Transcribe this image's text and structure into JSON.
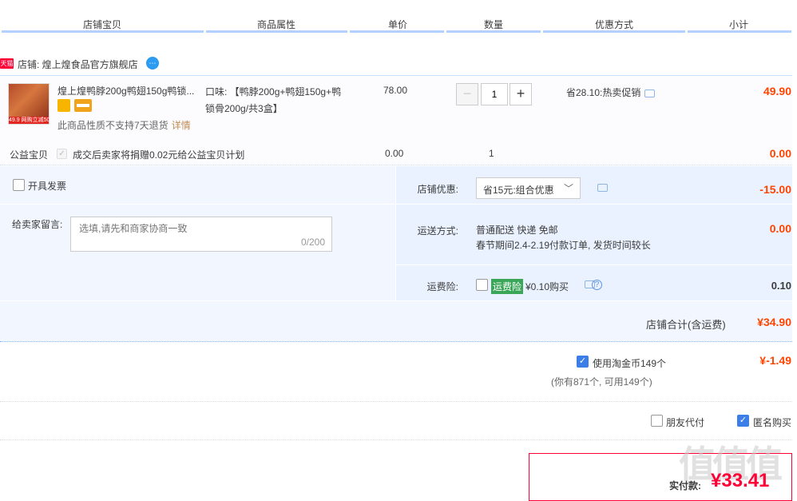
{
  "header": {
    "columns": [
      "店铺宝贝",
      "商品属性",
      "单价",
      "数量",
      "优惠方式",
      "小计"
    ]
  },
  "shop": {
    "badge": "天猫",
    "name": "店铺: 煌上煌食品官方旗舰店"
  },
  "item": {
    "thumb_tag": "49.9 网购立减50元",
    "title": "煌上煌鸭脖200g鸭翅150g鸭锁...",
    "no_return": "此商品性质不支持7天退货",
    "details_link": "详情",
    "attr": "口味: 【鸭脖200g+鸭翅150g+鸭锁骨200g/共3盒】",
    "price": "78.00",
    "qty_minus": "−",
    "qty_plus": "+",
    "quantity": "1",
    "promo": "省28.10:热卖促销",
    "subtotal": "49.90"
  },
  "charity": {
    "label": "公益宝贝",
    "text": "成交后卖家将捐赠0.02元给公益宝贝计划",
    "price": "0.00",
    "qty": "1",
    "subtotal": "0.00"
  },
  "order": {
    "invoice_label": "开具发票",
    "message_label": "给卖家留言:",
    "message_placeholder": "选填,请先和商家协商一致",
    "message_count": "0/200",
    "coupon_label": "店铺优惠:",
    "coupon_selected": "省15元:组合优惠",
    "coupon_value": "-15.00",
    "shipping_label": "运送方式:",
    "shipping_line1": "普通配送 快递 免邮",
    "shipping_line2": "春节期间2.4-2.19付款订单, 发货时间较长",
    "shipping_value": "0.00",
    "insurance_label": "运费险:",
    "insurance_tag": "运费险",
    "insurance_price": "¥0.10购买",
    "insurance_value": "0.10",
    "total_label": "店铺合计(含运费)",
    "total_value": "¥34.90"
  },
  "coins": {
    "label": "使用淘金币149个",
    "sub": "(你有871个, 可用149个)",
    "value": "¥-1.49"
  },
  "options": {
    "friend_pay": "朋友代付",
    "anonymous": "匿名购买"
  },
  "pay": {
    "label": "实付款:",
    "value": "¥33.41"
  },
  "watermark": "值值值"
}
